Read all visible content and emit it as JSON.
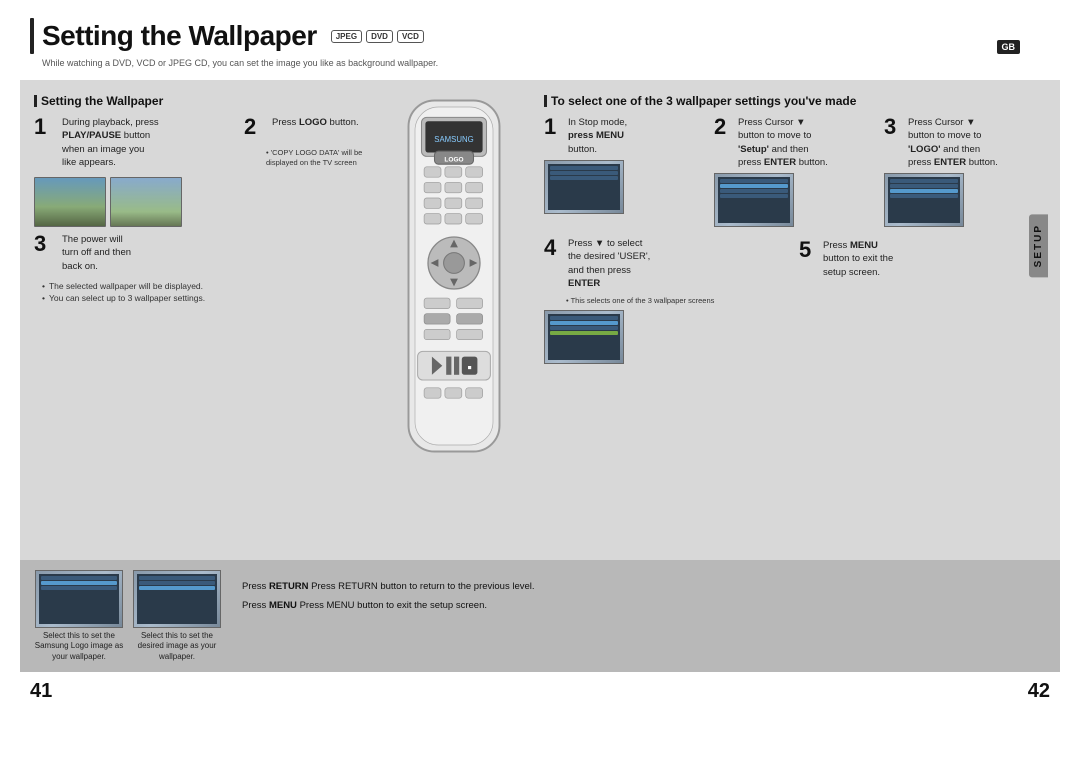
{
  "page": {
    "left_page_num": "41",
    "right_page_num": "42"
  },
  "header": {
    "title": "Setting the Wallpaper",
    "subtitle": "While watching a DVD, VCD or JPEG CD, you can set the image you like as background wallpaper.",
    "badges": [
      "JPEG",
      "DVD",
      "VCD"
    ],
    "gb_label": "GB"
  },
  "left_section": {
    "title": "Setting the Wallpaper",
    "step1": {
      "number": "1",
      "text_line1": "During playback, press",
      "text_bold": "PLAY/PAUSE",
      "text_line2": "button",
      "text_line3": "when an image you",
      "text_line4": "like appears."
    },
    "step2": {
      "number": "2",
      "text_pre": "Press ",
      "text_bold": "LOGO",
      "text_post": " button."
    },
    "note_copy": "• 'COPY LOGO DATA' will be displayed on the TV screen",
    "step3": {
      "number": "3",
      "text_line1": "The power will",
      "text_line2": "turn off and then",
      "text_line3": "back on."
    },
    "bullets": [
      "The selected wallpaper will be displayed.",
      "You can select up to 3 wallpaper settings."
    ]
  },
  "right_section": {
    "title": "To select one of the 3 wallpaper settings you've made",
    "step1": {
      "number": "1",
      "text_line1": "In Stop mode,",
      "text_bold": "press MENU",
      "text_line2": "button."
    },
    "step2": {
      "number": "2",
      "text_pre": "Press Cursor ▼",
      "text_line1": "button to move to",
      "text_bold": "'Setup'",
      "text_line2": "and then",
      "text_line3": "press ",
      "text_bold2": "ENTER",
      "text_post": " button."
    },
    "step3": {
      "number": "3",
      "text_pre": "Press Cursor ▼",
      "text_line1": "button to move to",
      "text_bold": "'LOGO'",
      "text_line2": "and then",
      "text_line3": "press ",
      "text_bold2": "ENTER",
      "text_post": " button."
    },
    "step4": {
      "number": "4",
      "text_pre": "Press ▼ to select",
      "text_line1": "the desired 'USER',",
      "text_line2": "and then press",
      "text_bold": "ENTER"
    },
    "step4_note": "• This selects one of the 3 wallpaper screens",
    "step5": {
      "number": "5",
      "text_pre": "Press ",
      "text_bold": "MENU",
      "text_line1": "button to exit the",
      "text_line2": "setup screen."
    },
    "setup_tab": "SETUP"
  },
  "bottom_section": {
    "thumb1_label": "Select this to set the Samsung Logo image as your wallpaper.",
    "thumb2_label": "Select this to set the desired image as your wallpaper.",
    "note1": "Press RETURN button to return to the previous level.",
    "note2": "Press MENU button to exit the setup screen."
  }
}
